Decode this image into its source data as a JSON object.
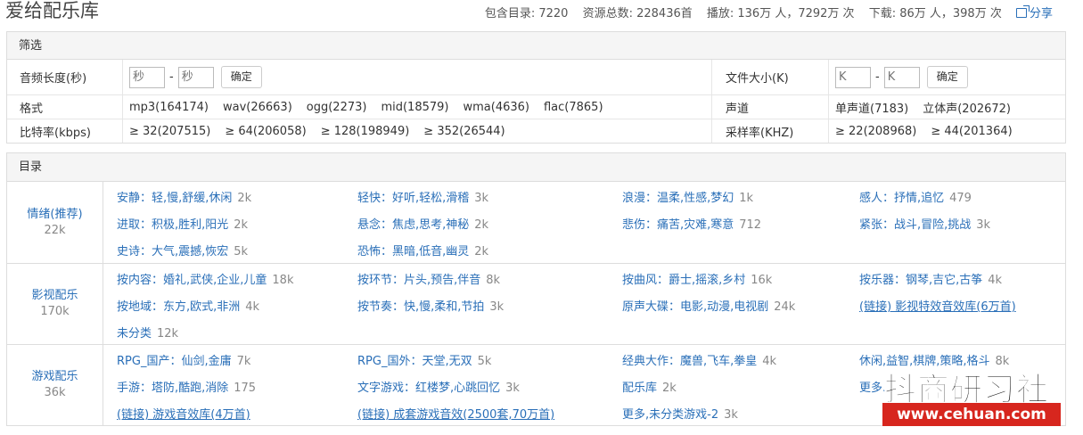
{
  "header": {
    "title": "爱给配乐库",
    "stats": {
      "catalogs": "包含目录: 7220",
      "total": "资源总数: 228436首",
      "plays": "播放: 136万 人，7292万 次",
      "downloads": "下载: 86万 人，398万 次",
      "share": "分享"
    }
  },
  "filter": {
    "heading": "筛选",
    "duration": {
      "label": "音频长度(秒)",
      "from_placeholder": "秒",
      "to_placeholder": "秒",
      "dash": "-",
      "confirm": "确定"
    },
    "filesize": {
      "label": "文件大小(K)",
      "from_placeholder": "K",
      "to_placeholder": "K",
      "dash": "-",
      "confirm": "确定"
    },
    "format": {
      "label": "格式",
      "options": [
        "mp3(164174)",
        "wav(26663)",
        "ogg(2273)",
        "mid(18579)",
        "wma(4636)",
        "flac(7865)"
      ]
    },
    "channel": {
      "label": "声道",
      "options": [
        "单声道(7183)",
        "立体声(202672)"
      ]
    },
    "bitrate": {
      "label": "比特率(kbps)",
      "options": [
        "≥ 32(207515)",
        "≥ 64(206058)",
        "≥ 128(198949)",
        "≥ 352(26544)"
      ]
    },
    "samplerate": {
      "label": "采样率(KHZ)",
      "options": [
        "≥ 22(208968)",
        "≥ 44(201364)"
      ]
    }
  },
  "catalog": {
    "heading": "目录",
    "groups": [
      {
        "name": "情绪(推荐)",
        "count": "22k",
        "items": [
          {
            "t": "安静：轻,慢,舒缓,休闲",
            "n": "2k"
          },
          {
            "t": "轻快：好听,轻松,滑稽",
            "n": "3k"
          },
          {
            "t": "浪漫：温柔,性感,梦幻",
            "n": "1k"
          },
          {
            "t": "感人：抒情,追忆",
            "n": "479"
          },
          {
            "t": "进取：积极,胜利,阳光",
            "n": "2k"
          },
          {
            "t": "悬念：焦虑,思考,神秘",
            "n": "2k"
          },
          {
            "t": "悲伤：痛苦,灾难,寒意",
            "n": "712"
          },
          {
            "t": "紧张：战斗,冒险,挑战",
            "n": "3k"
          },
          {
            "t": "史诗：大气,震撼,恢宏",
            "n": "5k"
          },
          {
            "t": "恐怖：黑暗,低音,幽灵",
            "n": "2k"
          }
        ]
      },
      {
        "name": "影视配乐",
        "count": "170k",
        "items": [
          {
            "t": "按内容：婚礼,武侠,企业,儿童",
            "n": "18k"
          },
          {
            "t": "按环节：片头,预告,伴音",
            "n": "8k"
          },
          {
            "t": "按曲风：爵士,摇滚,乡村",
            "n": "16k"
          },
          {
            "t": "按乐器：钢琴,吉它,古筝",
            "n": "4k"
          },
          {
            "t": "按地域：东方,欧式,非洲",
            "n": "4k"
          },
          {
            "t": "按节奏：快,慢,柔和,节拍",
            "n": "3k"
          },
          {
            "t": "原声大碟：电影,动漫,电视剧",
            "n": "24k"
          },
          {
            "t": "(链接) 影视特效音效库(6万首)",
            "n": ""
          },
          {
            "t": "未分类",
            "n": "12k"
          }
        ]
      },
      {
        "name": "游戏配乐",
        "count": "36k",
        "items": [
          {
            "t": "RPG_国产：仙剑,金庸",
            "n": "7k"
          },
          {
            "t": "RPG_国外：天堂,无双",
            "n": "5k"
          },
          {
            "t": "经典大作：魔兽,飞车,拳皇",
            "n": "4k"
          },
          {
            "t": "休闲,益智,棋牌,策略,格斗",
            "n": "8k"
          },
          {
            "t": "手游：塔防,酷跑,消除",
            "n": "175"
          },
          {
            "t": "文字游戏：红楼梦,心跳回忆",
            "n": "3k"
          },
          {
            "t": "配乐库",
            "n": "2k"
          },
          {
            "t": "更多...",
            "n": ""
          },
          {
            "t": "(链接) 游戏音效库(4万首)",
            "n": ""
          },
          {
            "t": "(链接) 成套游戏音效(2500套,70万首)",
            "n": ""
          },
          {
            "t": "更多,未分类游戏-2",
            "n": "3k"
          }
        ]
      }
    ]
  },
  "watermark": {
    "cn": "抖商研习社",
    "url": "www.cehuan.com"
  }
}
